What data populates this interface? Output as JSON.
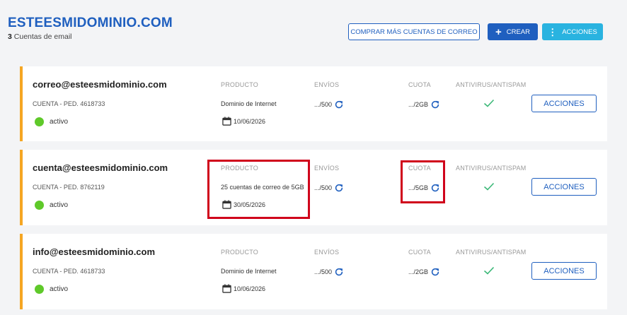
{
  "header": {
    "domain": "ESTEESMIDOMINIO.COM",
    "count_number": "3",
    "count_label": "Cuentas de email",
    "buy_button": "COMPRAR MÁS CUENTAS DE CORREO",
    "create_button": "CREAR",
    "actions_button": "ACCIONES"
  },
  "labels": {
    "product": "PRODUCTO",
    "sends": "ENVÍOS",
    "quota": "CUOTA",
    "antivirus": "ANTIVIRUS/ANTISPAM",
    "actions": "ACCIONES"
  },
  "accounts": [
    {
      "email": "correo@esteesmidominio.com",
      "account_ref": "CUENTA - PED. 4618733",
      "status": "activo",
      "product": "Dominio de Internet",
      "date": "10/06/2026",
      "sends": ".../500",
      "quota": ".../2GB"
    },
    {
      "email": "cuenta@esteesmidominio.com",
      "account_ref": "CUENTA - PED. 8762119",
      "status": "activo",
      "product": "25 cuentas de correo de 5GB",
      "date": "30/05/2026",
      "sends": ".../500",
      "quota": ".../5GB"
    },
    {
      "email": "info@esteesmidominio.com",
      "account_ref": "CUENTA - PED. 4618733",
      "status": "activo",
      "product": "Dominio de Internet",
      "date": "10/06/2026",
      "sends": ".../500",
      "quota": ".../2GB"
    }
  ],
  "colors": {
    "brand_blue": "#1f5fbf",
    "accent_cyan": "#29b3e0",
    "card_border": "#f5a623",
    "status_active": "#5fc92a",
    "check_green": "#3cb878",
    "highlight_red": "#d0021b"
  },
  "icons": {
    "create": "plus-icon",
    "actions": "vertical-dots-icon",
    "date": "calendar-icon",
    "refresh": "refresh-icon",
    "antivirus": "checkmark-icon",
    "status": "status-dot"
  }
}
